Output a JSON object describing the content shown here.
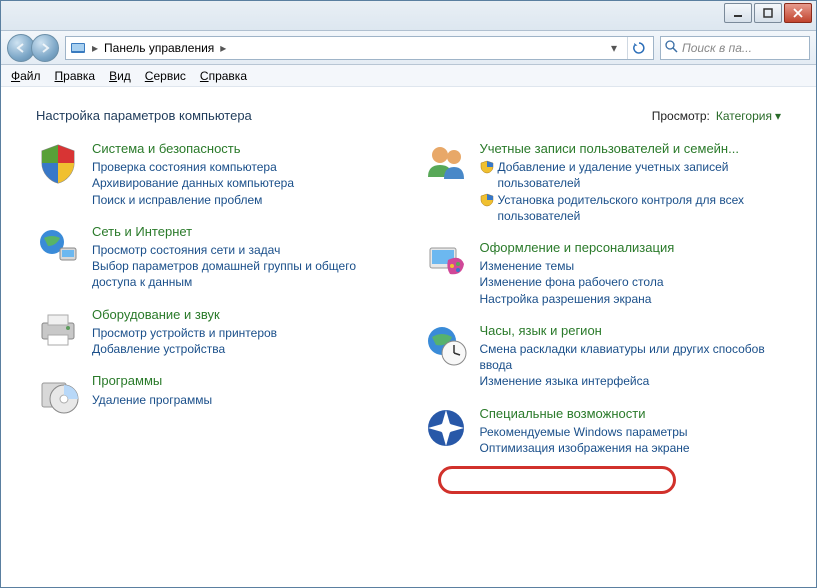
{
  "titlebar": {
    "minimize": "minimize",
    "maximize": "maximize",
    "close": "close"
  },
  "nav": {
    "crumb_root": "Панель управления",
    "search_placeholder": "Поиск в па...",
    "refresh": "refresh"
  },
  "menu": {
    "file": "Файл",
    "edit": "Правка",
    "view": "Вид",
    "tools": "Сервис",
    "help": "Справка"
  },
  "header": {
    "title": "Настройка параметров компьютера",
    "view_label": "Просмотр:",
    "view_value": "Категория"
  },
  "left": [
    {
      "title": "Система и безопасность",
      "links": [
        "Проверка состояния компьютера",
        "Архивирование данных компьютера",
        "Поиск и исправление проблем"
      ]
    },
    {
      "title": "Сеть и Интернет",
      "links": [
        "Просмотр состояния сети и задач",
        "Выбор параметров домашней группы и общего доступа к данным"
      ]
    },
    {
      "title": "Оборудование и звук",
      "links": [
        "Просмотр устройств и принтеров",
        "Добавление устройства"
      ]
    },
    {
      "title": "Программы",
      "links": [
        "Удаление программы"
      ]
    }
  ],
  "right": [
    {
      "title": "Учетные записи пользователей и семейн...",
      "links": [
        {
          "text": "Добавление и удаление учетных записей пользователей",
          "shield": true
        },
        {
          "text": "Установка родительского контроля для всех пользователей",
          "shield": true
        }
      ]
    },
    {
      "title": "Оформление и персонализация",
      "links": [
        {
          "text": "Изменение темы"
        },
        {
          "text": "Изменение фона рабочего стола"
        },
        {
          "text": "Настройка разрешения экрана"
        }
      ]
    },
    {
      "title": "Часы, язык и регион",
      "links": [
        {
          "text": "Смена раскладки клавиатуры или других способов ввода"
        },
        {
          "text": "Изменение языка интерфейса"
        }
      ]
    },
    {
      "title": "Специальные возможности",
      "links": [
        {
          "text": "Рекомендуемые Windows параметры"
        },
        {
          "text": "Оптимизация изображения на экране"
        }
      ]
    }
  ]
}
